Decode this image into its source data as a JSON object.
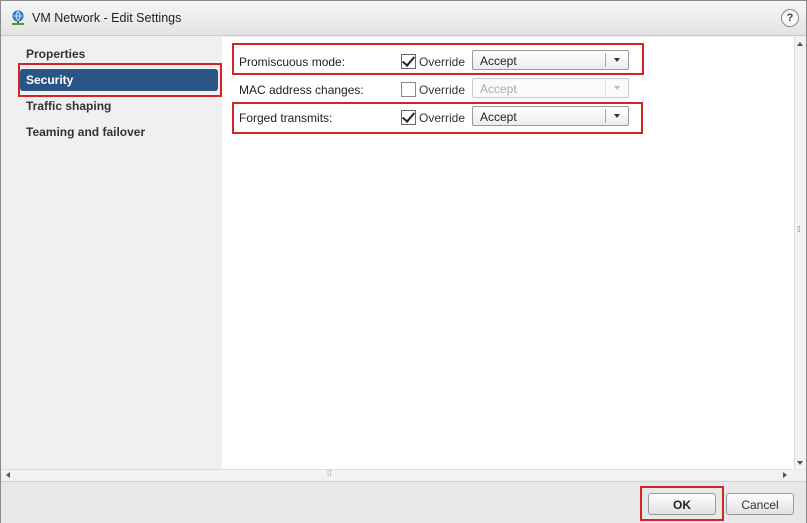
{
  "dialog": {
    "title": "VM Network - Edit Settings",
    "help_label": "?",
    "title_icon": "network-icon"
  },
  "sidebar": {
    "items": [
      {
        "label": "Properties",
        "selected": false
      },
      {
        "label": "Security",
        "selected": true
      },
      {
        "label": "Traffic shaping",
        "selected": false
      },
      {
        "label": "Teaming and failover",
        "selected": false
      }
    ]
  },
  "security": {
    "rows": [
      {
        "label": "Promiscuous mode:",
        "override_label": "Override",
        "override_checked": true,
        "value": "Accept",
        "enabled": true
      },
      {
        "label": "MAC address changes:",
        "override_label": "Override",
        "override_checked": false,
        "value": "Accept",
        "enabled": false
      },
      {
        "label": "Forged transmits:",
        "override_label": "Override",
        "override_checked": true,
        "value": "Accept",
        "enabled": true
      }
    ]
  },
  "footer": {
    "ok_label": "OK",
    "cancel_label": "Cancel"
  },
  "colors": {
    "selected_nav": "#2b5587",
    "highlight": "#d42525"
  }
}
